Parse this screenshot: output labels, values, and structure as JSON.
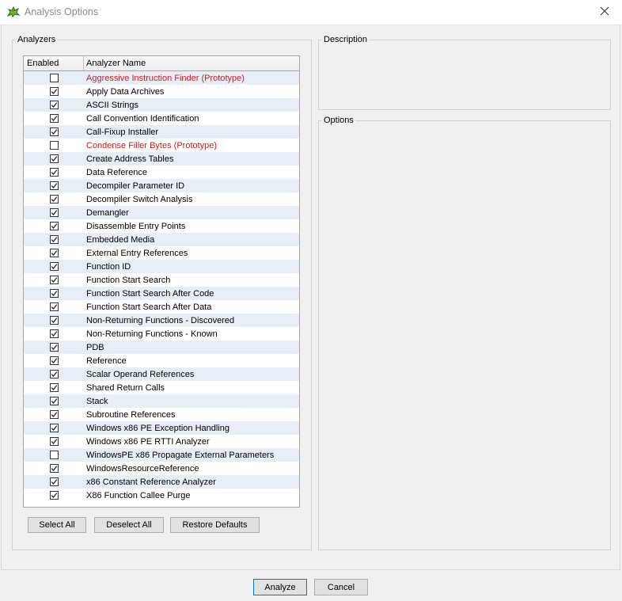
{
  "window": {
    "title": "Analysis Options"
  },
  "analyzers_group": {
    "legend": "Analyzers"
  },
  "description_group": {
    "legend": "Description"
  },
  "options_group": {
    "legend": "Options"
  },
  "table": {
    "headers": {
      "enabled": "Enabled",
      "name": "Analyzer Name"
    },
    "rows": [
      {
        "name": "Aggressive Instruction Finder (Prototype)",
        "enabled": false,
        "prototype": true
      },
      {
        "name": "Apply Data Archives",
        "enabled": true,
        "prototype": false
      },
      {
        "name": "ASCII Strings",
        "enabled": true,
        "prototype": false
      },
      {
        "name": "Call Convention Identification",
        "enabled": true,
        "prototype": false
      },
      {
        "name": "Call-Fixup Installer",
        "enabled": true,
        "prototype": false
      },
      {
        "name": "Condense Filler Bytes (Prototype)",
        "enabled": false,
        "prototype": true
      },
      {
        "name": "Create Address Tables",
        "enabled": true,
        "prototype": false
      },
      {
        "name": "Data Reference",
        "enabled": true,
        "prototype": false
      },
      {
        "name": "Decompiler Parameter ID",
        "enabled": true,
        "prototype": false
      },
      {
        "name": "Decompiler Switch Analysis",
        "enabled": true,
        "prototype": false
      },
      {
        "name": "Demangler",
        "enabled": true,
        "prototype": false
      },
      {
        "name": "Disassemble Entry Points",
        "enabled": true,
        "prototype": false
      },
      {
        "name": "Embedded Media",
        "enabled": true,
        "prototype": false
      },
      {
        "name": "External Entry References",
        "enabled": true,
        "prototype": false
      },
      {
        "name": "Function ID",
        "enabled": true,
        "prototype": false
      },
      {
        "name": "Function Start Search",
        "enabled": true,
        "prototype": false
      },
      {
        "name": "Function Start Search After Code",
        "enabled": true,
        "prototype": false
      },
      {
        "name": "Function Start Search After Data",
        "enabled": true,
        "prototype": false
      },
      {
        "name": "Non-Returning Functions - Discovered",
        "enabled": true,
        "prototype": false
      },
      {
        "name": "Non-Returning Functions - Known",
        "enabled": true,
        "prototype": false
      },
      {
        "name": "PDB",
        "enabled": true,
        "prototype": false
      },
      {
        "name": "Reference",
        "enabled": true,
        "prototype": false
      },
      {
        "name": "Scalar Operand References",
        "enabled": true,
        "prototype": false
      },
      {
        "name": "Shared Return Calls",
        "enabled": true,
        "prototype": false
      },
      {
        "name": "Stack",
        "enabled": true,
        "prototype": false
      },
      {
        "name": "Subroutine References",
        "enabled": true,
        "prototype": false
      },
      {
        "name": "Windows x86 PE Exception Handling",
        "enabled": true,
        "prototype": false
      },
      {
        "name": "Windows x86 PE RTTI Analyzer",
        "enabled": true,
        "prototype": false
      },
      {
        "name": "WindowsPE x86 Propagate External Parameters",
        "enabled": false,
        "prototype": false
      },
      {
        "name": "WindowsResourceReference",
        "enabled": true,
        "prototype": false
      },
      {
        "name": "x86 Constant Reference Analyzer",
        "enabled": true,
        "prototype": false
      },
      {
        "name": "X86 Function Callee Purge",
        "enabled": true,
        "prototype": false
      }
    ]
  },
  "buttons": {
    "select_all": "Select All",
    "deselect_all": "Deselect All",
    "restore_defaults": "Restore Defaults",
    "analyze": "Analyze",
    "cancel": "Cancel"
  },
  "colors": {
    "prototype_text": "#d11a1a",
    "alt_row": "#e8eef7",
    "default_button_border": "#0078d7"
  },
  "icons": {
    "app": "dragon-icon",
    "close": "close-icon",
    "check": "checkmark-icon"
  }
}
